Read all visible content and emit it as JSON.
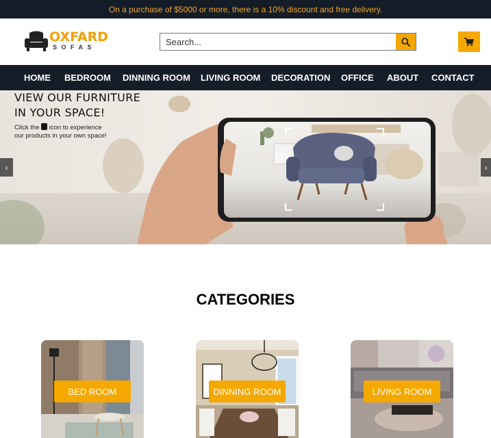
{
  "promo": {
    "text": "On a purchase of $5000 or more, there is a 10% discount and free delivery."
  },
  "logo": {
    "brand": "OXFARD",
    "sub": "SOFAS",
    "icon": "armchair-icon"
  },
  "search": {
    "placeholder": "Search...",
    "icon": "search-icon"
  },
  "cart": {
    "icon": "cart-icon"
  },
  "nav": {
    "items": [
      "HOME",
      "BEDROOM",
      "DINNING ROOM",
      "LIVING ROOM",
      "DECORATION",
      "OFFICE",
      "ABOUT",
      "CONTACT"
    ]
  },
  "hero": {
    "headline_1": "VIEW OUR FURNITURE",
    "headline_2": "IN YOUR SPACE!",
    "sub_1": "Click the",
    "sub_2": "icon to experience",
    "sub_3": "our products in your own space!",
    "prev": "‹",
    "next": "›"
  },
  "categories": {
    "title": "CATEGORIES",
    "items": [
      {
        "label": "BED ROOM"
      },
      {
        "label": "DINNING ROOM"
      },
      {
        "label": "LIVING ROOM"
      }
    ]
  },
  "colors": {
    "accent": "#f5a800",
    "dark": "#151d29"
  }
}
